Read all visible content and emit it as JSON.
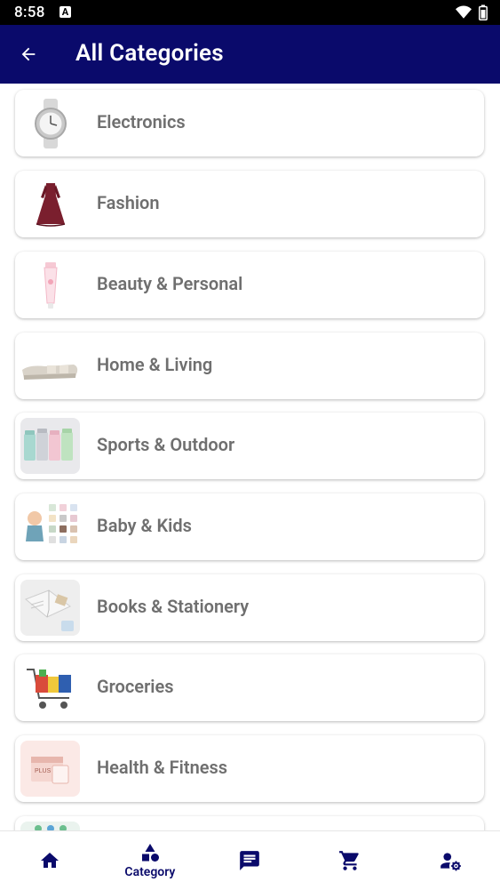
{
  "status": {
    "time": "8:58",
    "notif_icon": "a-notification-icon"
  },
  "header": {
    "title": "All Categories"
  },
  "categories": [
    {
      "label": "Electronics",
      "icon": "smartwatch"
    },
    {
      "label": "Fashion",
      "icon": "dress"
    },
    {
      "label": "Beauty & Personal",
      "icon": "cosmetic-tube"
    },
    {
      "label": "Home & Living",
      "icon": "sofa"
    },
    {
      "label": "Sports & Outdoor",
      "icon": "tumblers"
    },
    {
      "label": "Baby & Kids",
      "icon": "baby-clothes"
    },
    {
      "label": "Books & Stationery",
      "icon": "notebook"
    },
    {
      "label": "Groceries",
      "icon": "shopping-cart"
    },
    {
      "label": "Health & Fitness",
      "icon": "supplement-box"
    }
  ],
  "bottom_nav": {
    "items": [
      {
        "name": "home",
        "label": ""
      },
      {
        "name": "category",
        "label": "Category"
      },
      {
        "name": "messages",
        "label": ""
      },
      {
        "name": "cart",
        "label": ""
      },
      {
        "name": "account-settings",
        "label": ""
      }
    ],
    "accent": "#0a0a6b"
  },
  "colors": {
    "appbar": "#0a0a6b",
    "label_text": "#6f6f6f"
  }
}
